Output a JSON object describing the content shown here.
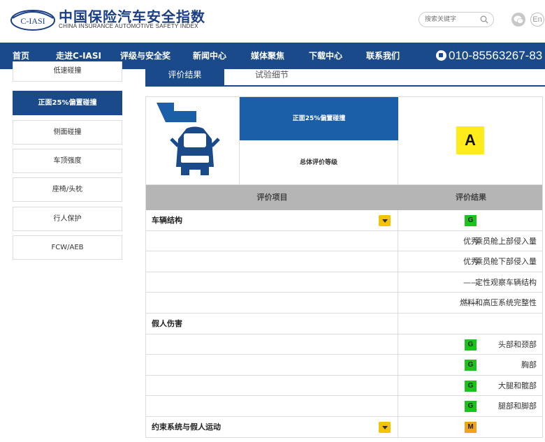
{
  "brand": {
    "logo_text": "C-IASI",
    "name_cn": "中国保险汽车安全指数",
    "name_en": "CHINA INSURANCE AUTOMOTIVE SAFETY INDEX"
  },
  "header": {
    "search_placeholder": "搜索关键字",
    "lang_label": "En"
  },
  "nav": {
    "items": [
      "首页",
      "走进C-IASI",
      "评级与安全奖",
      "新闻中心",
      "媒体聚焦",
      "下载中心",
      "联系我们"
    ],
    "phone": "010-85563267-83"
  },
  "sidebar": {
    "items": [
      "低速碰撞",
      "正面25%偏置碰撞",
      "侧面碰撞",
      "车顶强度",
      "座椅/头枕",
      "行人保护",
      "FCW/AEB"
    ],
    "active_index": 1
  },
  "tabs": {
    "items": [
      "评价结果",
      "试验细节"
    ],
    "active_index": 0
  },
  "result": {
    "test_type": "正面25%偏置碰撞",
    "overall_label": "总体评价等级",
    "overall_grade": "A",
    "columns": [
      "评价项目",
      "评价结果"
    ],
    "rows": [
      {
        "kind": "group",
        "label": "车辆结构",
        "result": "G",
        "color": "#1ec21e"
      },
      {
        "kind": "sub",
        "label": "乘员舱上部侵入量",
        "result": "优秀"
      },
      {
        "kind": "sub",
        "label": "乘员舱下部侵入量",
        "result": "优秀"
      },
      {
        "kind": "sub",
        "label": "定性观察车辆结构",
        "result": "——"
      },
      {
        "kind": "sub",
        "label": "燃料和高压系统完整性",
        "result": "——"
      },
      {
        "kind": "group-plain",
        "label": "假人伤害",
        "result": ""
      },
      {
        "kind": "sub-badge",
        "label": "头部和颈部",
        "result": "G",
        "color": "#1ec21e"
      },
      {
        "kind": "sub-badge",
        "label": "胸部",
        "result": "G",
        "color": "#1ec21e"
      },
      {
        "kind": "sub-badge",
        "label": "大腿和髋部",
        "result": "G",
        "color": "#1ec21e"
      },
      {
        "kind": "sub-badge",
        "label": "腿部和脚部",
        "result": "G",
        "color": "#1ec21e"
      },
      {
        "kind": "group",
        "label": "约束系统与假人运动",
        "result": "M",
        "color": "#f0a11d"
      }
    ]
  },
  "colors": {
    "primary": "#1a4a8a",
    "header_cell": "#1a5fa8",
    "grade_good": "#1ec21e",
    "grade_marginal": "#f0a11d",
    "grade_overall": "#ffec1a"
  }
}
